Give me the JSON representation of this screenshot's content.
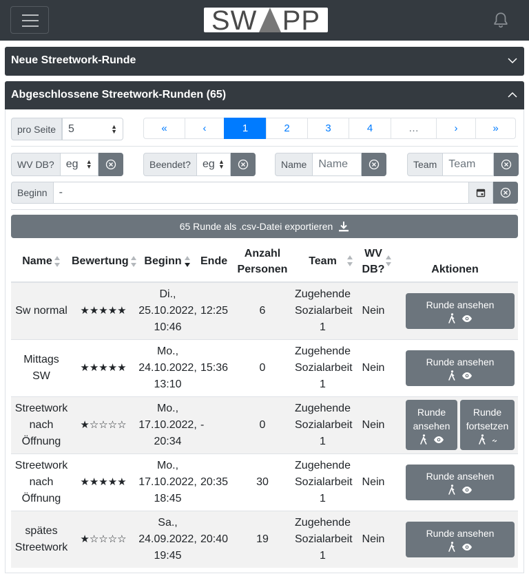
{
  "navbar": {
    "logo": "SW   PP"
  },
  "sections": {
    "new_round": "Neue Streetwork-Runde",
    "completed_rounds": "Abgeschlossene Streetwork-Runden (65)"
  },
  "per_page": {
    "label": "pro Seite",
    "value": "5"
  },
  "pagination": [
    "«",
    "‹",
    "1",
    "2",
    "3",
    "4",
    "…",
    "›",
    "»"
  ],
  "filters": {
    "wv_db": {
      "label": "WV DB?",
      "value": "eg"
    },
    "beendet": {
      "label": "Beendet?",
      "value": "eg"
    },
    "name": {
      "label": "Name",
      "placeholder": "Name"
    },
    "team": {
      "label": "Team",
      "placeholder": "Team"
    },
    "beginn": {
      "label": "Beginn",
      "value": "-"
    }
  },
  "export_label": "65 Runde als .csv-Datei exportieren",
  "table": {
    "headers": [
      "Name",
      "Bewertung",
      "Beginn",
      "Ende",
      "Anzahl Personen",
      "Team",
      "WV DB?",
      "Aktionen"
    ],
    "rows": [
      {
        "name": "Sw normal",
        "rating": "★★★★★",
        "begin": "Di., 25.10.2022, 10:46",
        "end": "12:25",
        "persons": "6",
        "team": "Zugehende Sozialarbeit 1",
        "wv": "Nein"
      },
      {
        "name": "Mittags SW",
        "rating": "★★★★★",
        "begin": "Mo., 24.10.2022, 13:10",
        "end": "15:36",
        "persons": "0",
        "team": "Zugehende Sozialarbeit 1",
        "wv": "Nein"
      },
      {
        "name": "Streetwork nach Öffnung",
        "rating": "★☆☆☆☆",
        "begin": "Mo., 17.10.2022, 20:34",
        "end": "-",
        "persons": "0",
        "team": "Zugehende Sozialarbeit 1",
        "wv": "Nein"
      },
      {
        "name": "Streetwork nach Öffnung",
        "rating": "★★★★★",
        "begin": "Mo., 17.10.2022, 18:45",
        "end": "20:35",
        "persons": "30",
        "team": "Zugehende Sozialarbeit 1",
        "wv": "Nein"
      },
      {
        "name": "spätes Streetwork",
        "rating": "★☆☆☆☆",
        "begin": "Sa., 24.09.2022, 19:45",
        "end": "20:40",
        "persons": "19",
        "team": "Zugehende Sozialarbeit 1",
        "wv": "Nein"
      }
    ],
    "view_button": "Runde ansehen",
    "view_short_1": "Runde",
    "view_short_2": "ansehen",
    "continue_1": "Runde",
    "continue_2": "fortsetzen"
  }
}
